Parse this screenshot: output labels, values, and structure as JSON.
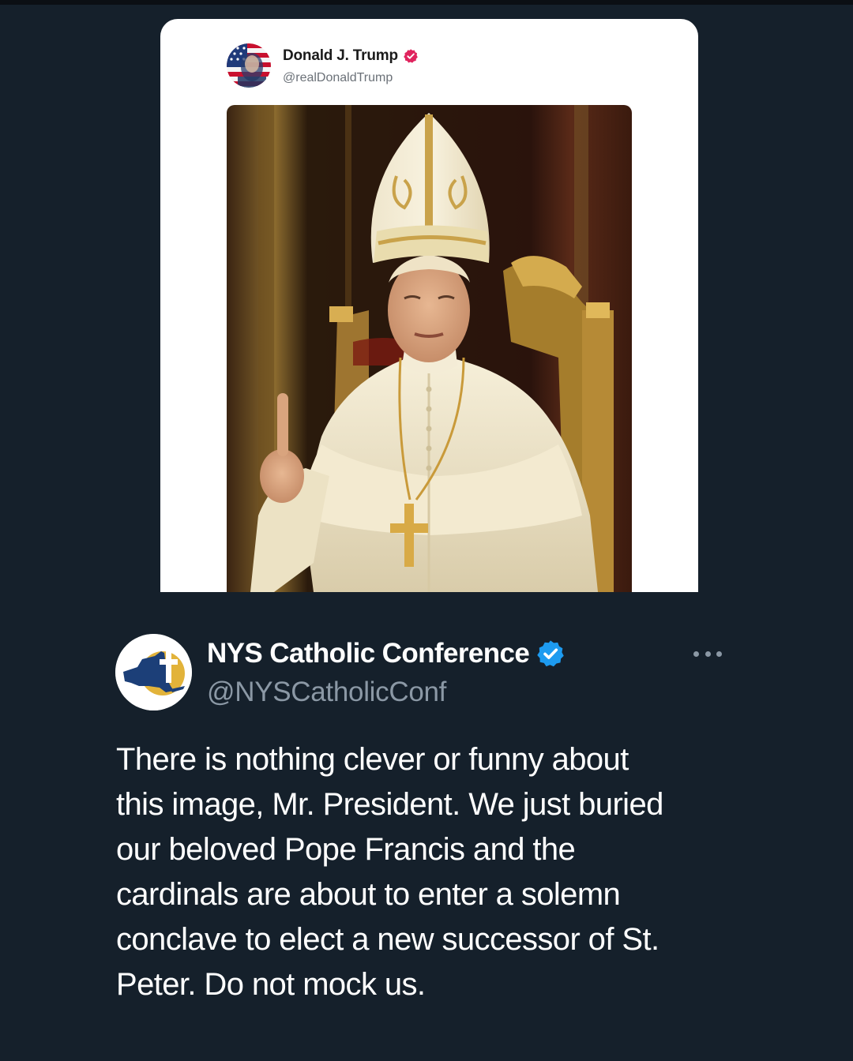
{
  "embedded_post": {
    "author_name": "Donald J. Trump",
    "author_handle": "@realDonaldTrump",
    "verified_badge_color": "#e0245e",
    "avatar_icon": "flag-portrait-avatar",
    "image_icon": "pope-portrait-image"
  },
  "tweet": {
    "author_name": "NYS Catholic Conference",
    "author_handle": "@NYSCatholicConf",
    "verified_badge_color": "#1d9bf0",
    "avatar_icon": "ny-state-cross-logo",
    "more_icon": "more-options-icon",
    "body_lines": [
      "There is nothing clever or funny about",
      "this image, Mr. President. We just buried",
      "our beloved Pope Francis and the",
      "cardinals are about to enter a solemn",
      "conclave to elect a new successor of St.",
      "Peter. Do not mock us."
    ]
  },
  "colors": {
    "background": "#15202b",
    "text_primary": "#ffffff",
    "text_secondary": "#8b98a5",
    "card_background": "#ffffff"
  }
}
